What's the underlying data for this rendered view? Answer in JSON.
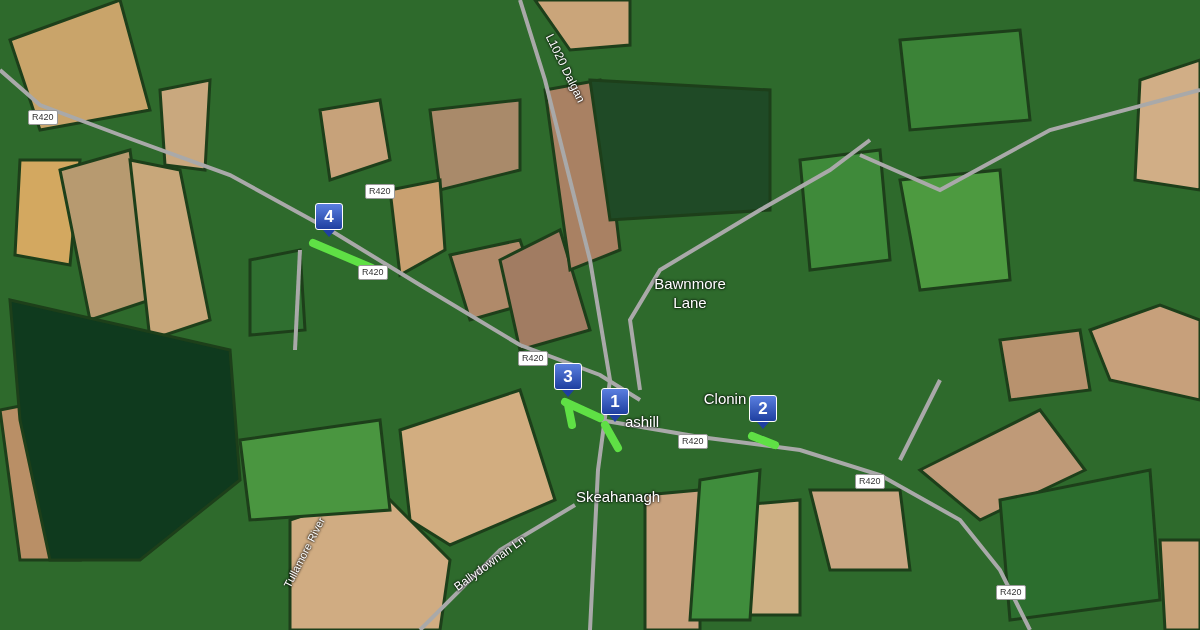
{
  "map": {
    "road_labels": [
      "R420",
      "R420",
      "R420",
      "R420",
      "R420",
      "R420",
      "R420"
    ],
    "place_labels": [
      {
        "text": "L1020 Dalgan",
        "kind": "road"
      },
      {
        "text": "Bawnmore Lane",
        "kind": "place"
      },
      {
        "text": "Clonin",
        "kind": "place"
      },
      {
        "text": "ashill",
        "kind": "place"
      },
      {
        "text": "Skeahanagh",
        "kind": "place"
      },
      {
        "text": "Ballydownan Ln",
        "kind": "road"
      },
      {
        "text": "Tullamore River",
        "kind": "water"
      }
    ],
    "markers": [
      {
        "label": "1"
      },
      {
        "label": "2"
      },
      {
        "label": "3"
      },
      {
        "label": "4"
      }
    ]
  }
}
